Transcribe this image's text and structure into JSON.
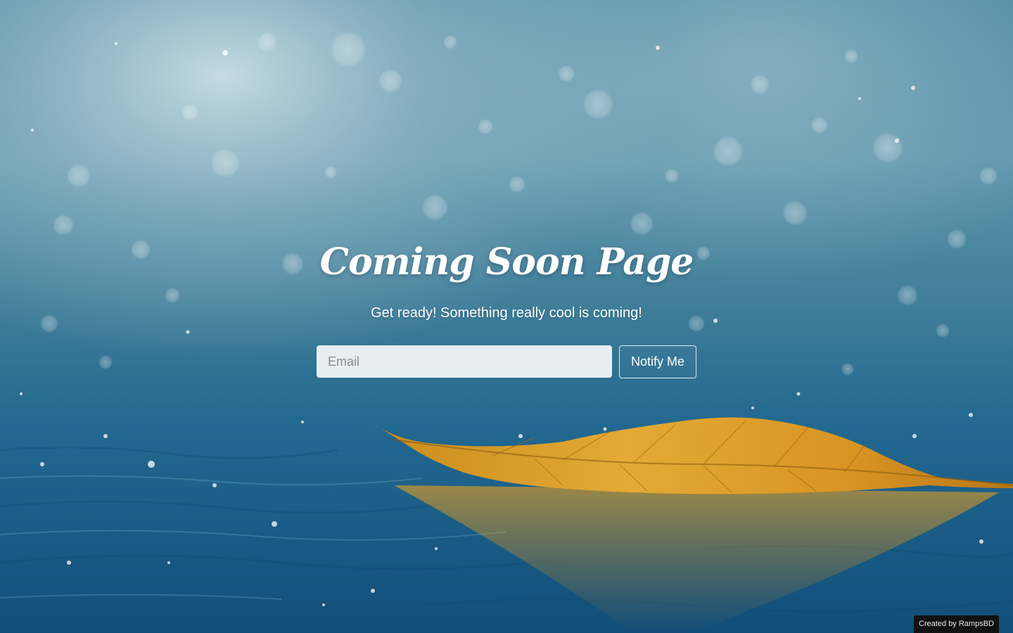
{
  "hero": {
    "title": "Coming Soon Page",
    "subtitle": "Get ready! Something really cool is coming!"
  },
  "form": {
    "email_placeholder": "Email",
    "email_value": "",
    "notify_label": "Notify Me"
  },
  "footer": {
    "credit": "Created by RampsBD"
  },
  "background": {
    "subject": "rain-on-water-with-floating-leaf-photo",
    "colors": {
      "sky_light": "#8fb6c6",
      "sky_mid": "#3d7c98",
      "water_deep": "#17587f",
      "leaf": "#e0a22a"
    }
  }
}
